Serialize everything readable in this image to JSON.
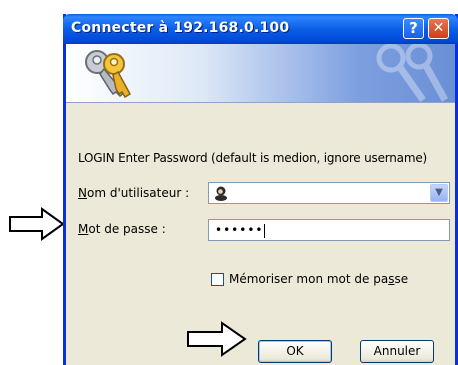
{
  "window": {
    "title": "Connecter à 192.168.0.100",
    "help_label": "?",
    "close_label": "✕"
  },
  "prompt": "LOGIN Enter Password (default is medion, ignore username)",
  "username": {
    "label_accel": "N",
    "label_rest": "om d'utilisateur :",
    "value": ""
  },
  "password": {
    "label_accel": "M",
    "label_rest": "ot de passe :",
    "masked_value": "••••••"
  },
  "remember": {
    "label_before": "Mémoriser mon mot de pa",
    "label_accel": "s",
    "label_after": "se",
    "checked": false
  },
  "buttons": {
    "ok_label": "OK",
    "cancel_label": "Annuler"
  },
  "colors": {
    "titlebar": "#0a5fe6",
    "dialog_bg": "#ece9d8",
    "input_border": "#7f9db9"
  }
}
